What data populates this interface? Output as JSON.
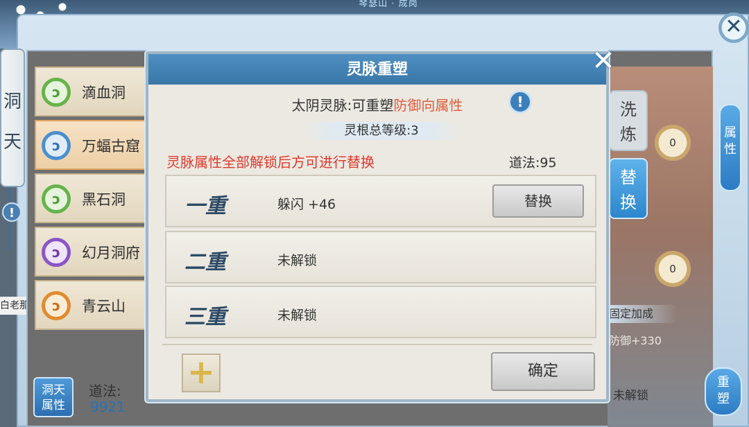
{
  "background": {
    "top_title": "琴瑟山 · 成岗",
    "left_banner_chars": [
      "洞",
      "天"
    ],
    "left_name_tag": "白老那",
    "cave_list": [
      {
        "name": "滴血洞",
        "color": "green",
        "selected": false
      },
      {
        "name": "万蝠古窟",
        "color": "blue",
        "selected": true
      },
      {
        "name": "黑石洞",
        "color": "green",
        "selected": false
      },
      {
        "name": "幻月洞府",
        "color": "purple",
        "selected": false
      },
      {
        "name": "青云山",
        "color": "orange",
        "selected": false
      }
    ],
    "left_attr_button_line1": "洞天",
    "left_attr_button_line2": "属性",
    "left_dao_label": "道法:",
    "left_dao_value": "9921",
    "wash_button_line1": "洗",
    "wash_button_line2": "炼",
    "replace_side_line1": "替",
    "replace_side_line2": "换",
    "badge_top_value": "0",
    "badge_bottom_value": "0",
    "fixed_bonus_label": "固定加成",
    "defense_bonus": "防御+330",
    "right_locked": "未解锁",
    "right_attr_line1": "属",
    "right_attr_line2": "性",
    "right_reshape_line1": "重",
    "right_reshape_line2": "塑"
  },
  "modal": {
    "title": "灵脉重塑",
    "vein_prefix": "太阴灵脉:可重塑",
    "vein_accent": "防御向属性",
    "total_level": "灵根总等级:3",
    "warning": "灵脉属性全部解锁后方可进行替换",
    "dao": "道法:95",
    "tiers": [
      {
        "name": "一重",
        "value": "躲闪 +46",
        "button": "替换"
      },
      {
        "name": "二重",
        "value": "未解锁"
      },
      {
        "name": "三重",
        "value": "未解锁"
      }
    ],
    "confirm_label": "确定"
  },
  "colors": {
    "accent_red": "#e0392c",
    "accent_orange": "#e25b3a",
    "header_blue": "#3a76a8",
    "dao_blue": "#2a72b8"
  }
}
